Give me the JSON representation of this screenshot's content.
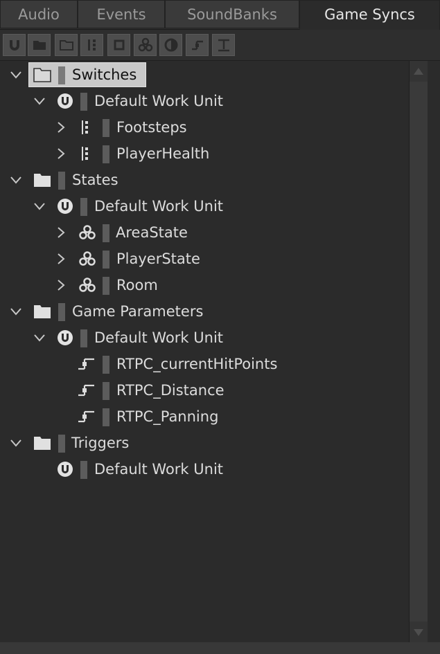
{
  "tabs": [
    {
      "label": "Audio"
    },
    {
      "label": "Events"
    },
    {
      "label": "SoundBanks"
    },
    {
      "label": "Game Syncs"
    }
  ],
  "toolbar": {
    "buttons": [
      {
        "icon": "work-unit-icon"
      },
      {
        "icon": "folder-icon"
      },
      {
        "icon": "open-folder-icon"
      },
      {
        "icon": "switch-group-icon"
      },
      {
        "icon": "switch-icon"
      },
      {
        "icon": "state-group-icon"
      },
      {
        "icon": "state-icon"
      },
      {
        "icon": "game-parameter-icon"
      },
      {
        "icon": "trigger-icon"
      }
    ]
  },
  "tree": {
    "rows": [
      {
        "label": "Switches",
        "type": "folder",
        "expanded": true,
        "selected": true
      },
      {
        "label": "Default Work Unit",
        "type": "work-unit",
        "expanded": true
      },
      {
        "label": "Footsteps",
        "type": "switch-group",
        "expanded": false
      },
      {
        "label": "PlayerHealth",
        "type": "switch-group",
        "expanded": false
      },
      {
        "label": "States",
        "type": "folder",
        "expanded": true
      },
      {
        "label": "Default Work Unit",
        "type": "work-unit",
        "expanded": true
      },
      {
        "label": "AreaState",
        "type": "state-group",
        "expanded": false
      },
      {
        "label": "PlayerState",
        "type": "state-group",
        "expanded": false
      },
      {
        "label": "Room",
        "type": "state-group",
        "expanded": false
      },
      {
        "label": "Game Parameters",
        "type": "folder",
        "expanded": true
      },
      {
        "label": "Default Work Unit",
        "type": "work-unit",
        "expanded": true
      },
      {
        "label": "RTPC_currentHitPoints",
        "type": "game-parameter"
      },
      {
        "label": "RTPC_Distance",
        "type": "game-parameter"
      },
      {
        "label": "RTPC_Panning",
        "type": "game-parameter"
      },
      {
        "label": "Triggers",
        "type": "folder",
        "expanded": true
      },
      {
        "label": "Default Work Unit",
        "type": "work-unit"
      }
    ]
  },
  "colors": {
    "background": "#2b2b2b",
    "selection": "#c9c9c9",
    "text": "#dcdcdc"
  }
}
